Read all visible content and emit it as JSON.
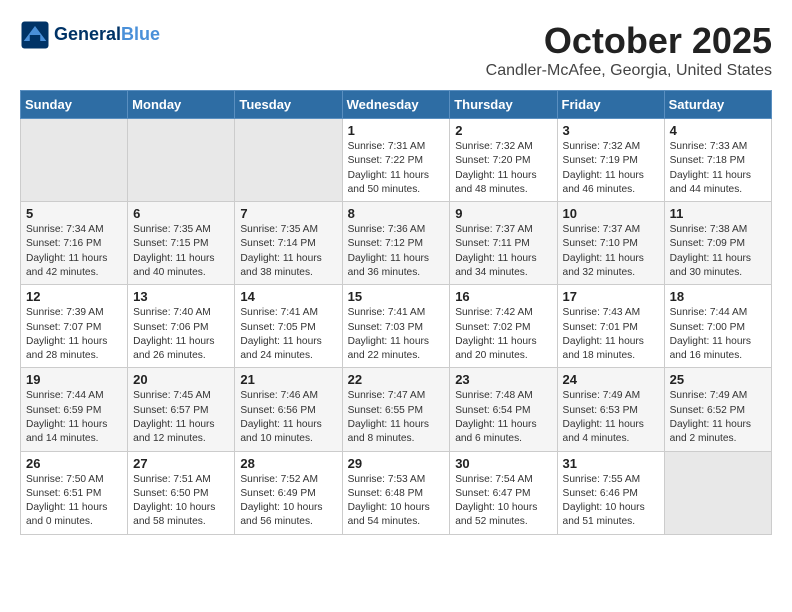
{
  "header": {
    "logo_line1": "General",
    "logo_line2": "Blue",
    "month_title": "October 2025",
    "location": "Candler-McAfee, Georgia, United States"
  },
  "days_of_week": [
    "Sunday",
    "Monday",
    "Tuesday",
    "Wednesday",
    "Thursday",
    "Friday",
    "Saturday"
  ],
  "weeks": [
    [
      {
        "day": "",
        "info": ""
      },
      {
        "day": "",
        "info": ""
      },
      {
        "day": "",
        "info": ""
      },
      {
        "day": "1",
        "info": "Sunrise: 7:31 AM\nSunset: 7:22 PM\nDaylight: 11 hours\nand 50 minutes."
      },
      {
        "day": "2",
        "info": "Sunrise: 7:32 AM\nSunset: 7:20 PM\nDaylight: 11 hours\nand 48 minutes."
      },
      {
        "day": "3",
        "info": "Sunrise: 7:32 AM\nSunset: 7:19 PM\nDaylight: 11 hours\nand 46 minutes."
      },
      {
        "day": "4",
        "info": "Sunrise: 7:33 AM\nSunset: 7:18 PM\nDaylight: 11 hours\nand 44 minutes."
      }
    ],
    [
      {
        "day": "5",
        "info": "Sunrise: 7:34 AM\nSunset: 7:16 PM\nDaylight: 11 hours\nand 42 minutes."
      },
      {
        "day": "6",
        "info": "Sunrise: 7:35 AM\nSunset: 7:15 PM\nDaylight: 11 hours\nand 40 minutes."
      },
      {
        "day": "7",
        "info": "Sunrise: 7:35 AM\nSunset: 7:14 PM\nDaylight: 11 hours\nand 38 minutes."
      },
      {
        "day": "8",
        "info": "Sunrise: 7:36 AM\nSunset: 7:12 PM\nDaylight: 11 hours\nand 36 minutes."
      },
      {
        "day": "9",
        "info": "Sunrise: 7:37 AM\nSunset: 7:11 PM\nDaylight: 11 hours\nand 34 minutes."
      },
      {
        "day": "10",
        "info": "Sunrise: 7:37 AM\nSunset: 7:10 PM\nDaylight: 11 hours\nand 32 minutes."
      },
      {
        "day": "11",
        "info": "Sunrise: 7:38 AM\nSunset: 7:09 PM\nDaylight: 11 hours\nand 30 minutes."
      }
    ],
    [
      {
        "day": "12",
        "info": "Sunrise: 7:39 AM\nSunset: 7:07 PM\nDaylight: 11 hours\nand 28 minutes."
      },
      {
        "day": "13",
        "info": "Sunrise: 7:40 AM\nSunset: 7:06 PM\nDaylight: 11 hours\nand 26 minutes."
      },
      {
        "day": "14",
        "info": "Sunrise: 7:41 AM\nSunset: 7:05 PM\nDaylight: 11 hours\nand 24 minutes."
      },
      {
        "day": "15",
        "info": "Sunrise: 7:41 AM\nSunset: 7:03 PM\nDaylight: 11 hours\nand 22 minutes."
      },
      {
        "day": "16",
        "info": "Sunrise: 7:42 AM\nSunset: 7:02 PM\nDaylight: 11 hours\nand 20 minutes."
      },
      {
        "day": "17",
        "info": "Sunrise: 7:43 AM\nSunset: 7:01 PM\nDaylight: 11 hours\nand 18 minutes."
      },
      {
        "day": "18",
        "info": "Sunrise: 7:44 AM\nSunset: 7:00 PM\nDaylight: 11 hours\nand 16 minutes."
      }
    ],
    [
      {
        "day": "19",
        "info": "Sunrise: 7:44 AM\nSunset: 6:59 PM\nDaylight: 11 hours\nand 14 minutes."
      },
      {
        "day": "20",
        "info": "Sunrise: 7:45 AM\nSunset: 6:57 PM\nDaylight: 11 hours\nand 12 minutes."
      },
      {
        "day": "21",
        "info": "Sunrise: 7:46 AM\nSunset: 6:56 PM\nDaylight: 11 hours\nand 10 minutes."
      },
      {
        "day": "22",
        "info": "Sunrise: 7:47 AM\nSunset: 6:55 PM\nDaylight: 11 hours\nand 8 minutes."
      },
      {
        "day": "23",
        "info": "Sunrise: 7:48 AM\nSunset: 6:54 PM\nDaylight: 11 hours\nand 6 minutes."
      },
      {
        "day": "24",
        "info": "Sunrise: 7:49 AM\nSunset: 6:53 PM\nDaylight: 11 hours\nand 4 minutes."
      },
      {
        "day": "25",
        "info": "Sunrise: 7:49 AM\nSunset: 6:52 PM\nDaylight: 11 hours\nand 2 minutes."
      }
    ],
    [
      {
        "day": "26",
        "info": "Sunrise: 7:50 AM\nSunset: 6:51 PM\nDaylight: 11 hours\nand 0 minutes."
      },
      {
        "day": "27",
        "info": "Sunrise: 7:51 AM\nSunset: 6:50 PM\nDaylight: 10 hours\nand 58 minutes."
      },
      {
        "day": "28",
        "info": "Sunrise: 7:52 AM\nSunset: 6:49 PM\nDaylight: 10 hours\nand 56 minutes."
      },
      {
        "day": "29",
        "info": "Sunrise: 7:53 AM\nSunset: 6:48 PM\nDaylight: 10 hours\nand 54 minutes."
      },
      {
        "day": "30",
        "info": "Sunrise: 7:54 AM\nSunset: 6:47 PM\nDaylight: 10 hours\nand 52 minutes."
      },
      {
        "day": "31",
        "info": "Sunrise: 7:55 AM\nSunset: 6:46 PM\nDaylight: 10 hours\nand 51 minutes."
      },
      {
        "day": "",
        "info": ""
      }
    ]
  ]
}
